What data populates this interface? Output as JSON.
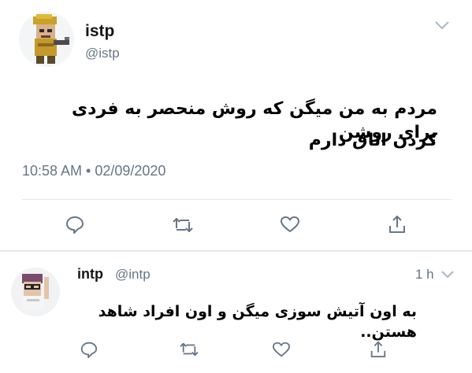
{
  "main_tweet": {
    "author_name": "istp",
    "author_handle": "@istp",
    "text_line1": "مردم به من میگن که روش منحصر به فردی برای روشن",
    "text_line2": "کردن اتاق دارم",
    "timestamp": "10:58 AM • 02/09/2020"
  },
  "reply_tweet": {
    "author_name": "intp",
    "author_handle": "@intp",
    "time": "1 h",
    "text": "به اون آتیش سوزی میگن و اون افراد شاهد هستن.."
  },
  "icons": {
    "reply": "reply-icon",
    "retweet": "retweet-icon",
    "like": "like-icon",
    "share": "share-icon",
    "more": "chevron-down-icon"
  }
}
